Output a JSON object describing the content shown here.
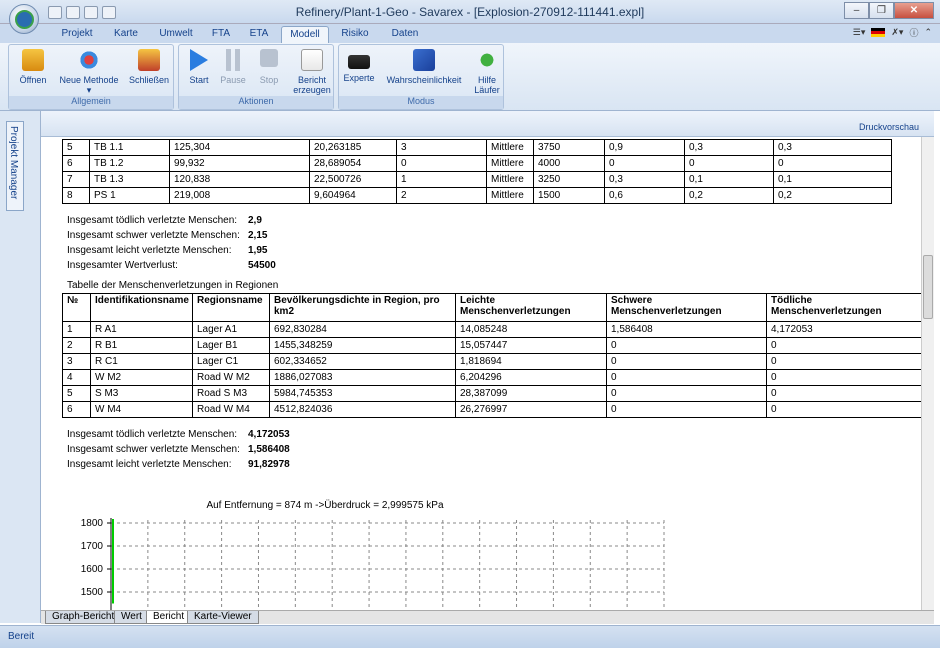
{
  "window": {
    "title": "Refinery/Plant-1-Geo - Savarex - [Explosion-270912-111441.expl]"
  },
  "tabs": [
    "Projekt",
    "Karte",
    "Umwelt",
    "FTA",
    "ETA",
    "Modell",
    "Risiko",
    "Daten"
  ],
  "active_tab": "Modell",
  "ribbon": {
    "groups": [
      {
        "label": "Allgemein"
      },
      {
        "label": "Aktionen"
      },
      {
        "label": "Modus"
      }
    ],
    "buttons": {
      "open": "Öffnen",
      "new_method": "Neue Methode",
      "close": "Schließen",
      "start": "Start",
      "pause": "Pause",
      "stop": "Stop",
      "report_l1": "Bericht",
      "report_l2": "erzeugen",
      "expert": "Experte",
      "probability": "Wahrscheinlichkeit",
      "help_l1": "Hilfe",
      "help_l2": "Läufer"
    }
  },
  "side_tab": "Projekt Manager",
  "toolbar": {
    "print_preview": "Druckvorschau"
  },
  "table1": {
    "rows": [
      [
        "5",
        "TB 1.1",
        "125,304",
        "20,263185",
        "3",
        "Mittlere",
        "3750",
        "0,9",
        "0,3",
        "0,3"
      ],
      [
        "6",
        "TB 1.2",
        "99,932",
        "28,689054",
        "0",
        "Mittlere",
        "4000",
        "0",
        "0",
        "0"
      ],
      [
        "7",
        "TB 1.3",
        "120,838",
        "22,500726",
        "1",
        "Mittlere",
        "3250",
        "0,3",
        "0,1",
        "0,1"
      ],
      [
        "8",
        "PS 1",
        "219,008",
        "9,604964",
        "2",
        "Mittlere",
        "1500",
        "0,6",
        "0,2",
        "0,2"
      ]
    ]
  },
  "summary1": [
    {
      "label": "Insgesamt tödlich verletzte Menschen:",
      "value": "2,9"
    },
    {
      "label": "Insgesamt schwer verletzte Menschen:",
      "value": "2,15"
    },
    {
      "label": "Insgesamt leicht verletzte Menschen:",
      "value": "1,95"
    },
    {
      "label": "Insgesamter Wertverlust:",
      "value": "54500"
    }
  ],
  "table2": {
    "caption": "Tabelle der Menschenverletzungen in Regionen",
    "headers": [
      "№",
      "Identifikationsname",
      "Regionsname",
      "Bevölkerungsdichte in Region, pro km2",
      "Leichte Menschenverletzungen",
      "Schwere Menschenverletzungen",
      "Tödliche Menschenverletzungen"
    ],
    "rows": [
      [
        "1",
        "R A1",
        "Lager A1",
        "692,830284",
        "14,085248",
        "1,586408",
        "4,172053"
      ],
      [
        "2",
        "R B1",
        "Lager B1",
        "1455,348259",
        "15,057447",
        "0",
        "0"
      ],
      [
        "3",
        "R C1",
        "Lager C1",
        "602,334652",
        "1,818694",
        "0",
        "0"
      ],
      [
        "4",
        "W M2",
        "Road W M2",
        "1886,027083",
        "6,204296",
        "0",
        "0"
      ],
      [
        "5",
        "S M3",
        "Road S M3",
        "5984,745353",
        "28,387099",
        "0",
        "0"
      ],
      [
        "6",
        "W M4",
        "Road W M4",
        "4512,824036",
        "26,276997",
        "0",
        "0"
      ]
    ]
  },
  "summary2": [
    {
      "label": "Insgesamt tödlich verletzte Menschen:",
      "value": "4,172053"
    },
    {
      "label": "Insgesamt schwer verletzte Menschen:",
      "value": "1,586408"
    },
    {
      "label": "Insgesamt leicht verletzte Menschen:",
      "value": "91,82978"
    }
  ],
  "chart_data": {
    "type": "line",
    "title": "Auf Entfernung =  874 m ->Überdruck =  2,999575 kPa",
    "y_ticks": [
      "1800",
      "1700",
      "1600",
      "1500"
    ],
    "ylim": [
      1450,
      1800
    ],
    "grid": true,
    "series": [
      {
        "color": "#00cc00",
        "x": [
          0,
          0
        ],
        "y": [
          1450,
          1800
        ]
      }
    ]
  },
  "bottom_tabs": [
    "Graph-Bericht",
    "Wert",
    "Bericht",
    "Karte-Viewer"
  ],
  "active_bottom_tab": "Bericht",
  "status": "Bereit"
}
